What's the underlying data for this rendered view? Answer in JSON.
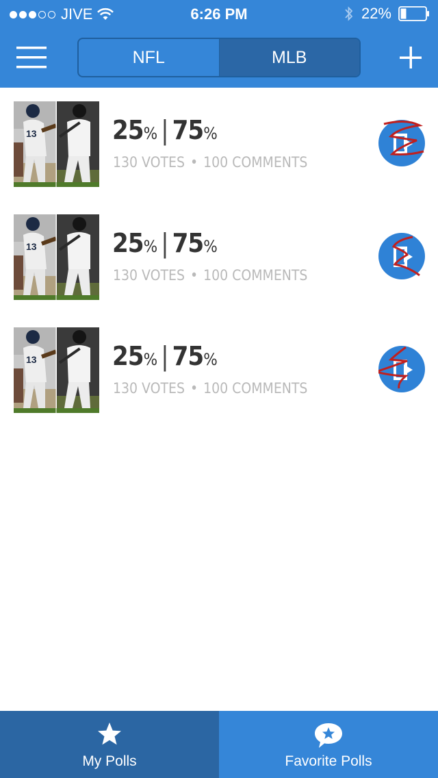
{
  "status_bar": {
    "carrier": "JIVE",
    "time": "6:26 PM",
    "battery": "22%",
    "signal_dots_filled": 3,
    "signal_dots_total": 5
  },
  "nav": {
    "segments": [
      {
        "label": "NFL",
        "active": false
      },
      {
        "label": "MLB",
        "active": true
      }
    ]
  },
  "polls": [
    {
      "left_pct": "25",
      "right_pct": "75",
      "pct_sign": "%",
      "votes": "130 VOTES",
      "comments": "100 COMMENTS",
      "separator": "•"
    },
    {
      "left_pct": "25",
      "right_pct": "75",
      "pct_sign": "%",
      "votes": "130 VOTES",
      "comments": "100 COMMENTS",
      "separator": "•"
    },
    {
      "left_pct": "25",
      "right_pct": "75",
      "pct_sign": "%",
      "votes": "130 VOTES",
      "comments": "100 COMMENTS",
      "separator": "•"
    }
  ],
  "tabs": [
    {
      "label": "My Polls",
      "icon": "star-icon",
      "active": true
    },
    {
      "label": "Favorite Polls",
      "icon": "chat-star-icon",
      "active": false
    }
  ],
  "colors": {
    "primary_blue": "#3586d8",
    "dark_blue": "#2b66a3",
    "share_button": "#2f82d6",
    "scribble_red": "#c0201f"
  }
}
